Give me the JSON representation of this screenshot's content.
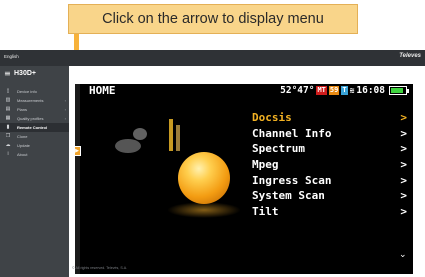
{
  "callout": {
    "text": "Click on the arrow to display menu"
  },
  "topbar": {
    "language": "English",
    "brand": "Televes"
  },
  "logo": {
    "text": "H30D+"
  },
  "sidebar": {
    "items": [
      {
        "label": "Device info",
        "icon": "device-icon"
      },
      {
        "label": "Measurements",
        "icon": "measurement-icon"
      },
      {
        "label": "Plans",
        "icon": "plans-icon"
      },
      {
        "label": "Quality profiles",
        "icon": "profiles-icon"
      },
      {
        "label": "Remote Control",
        "icon": "remote-icon",
        "active": true
      },
      {
        "label": "Clone",
        "icon": "clone-icon"
      },
      {
        "label": "Update",
        "icon": "update-icon"
      },
      {
        "label": "About",
        "icon": "info-icon"
      }
    ]
  },
  "footer": {
    "text": "© All rights reserved. Televés, S.A."
  },
  "device": {
    "home": "HOME",
    "angle": "52°47°",
    "badge_red": "MT",
    "badge_orange": "59",
    "badge_blue": "T",
    "time": "16:08",
    "battery_level": 0.85,
    "menu": [
      {
        "label": "Docsis",
        "arrow": ">",
        "active": true
      },
      {
        "label": "Channel Info",
        "arrow": ">"
      },
      {
        "label": "Spectrum",
        "arrow": ">"
      },
      {
        "label": "Mpeg",
        "arrow": ">"
      },
      {
        "label": "Ingress Scan",
        "arrow": ">"
      },
      {
        "label": "System Scan",
        "arrow": ">"
      },
      {
        "label": "Tilt",
        "arrow": ">"
      }
    ],
    "more_icon": "chevron-down-icon"
  }
}
